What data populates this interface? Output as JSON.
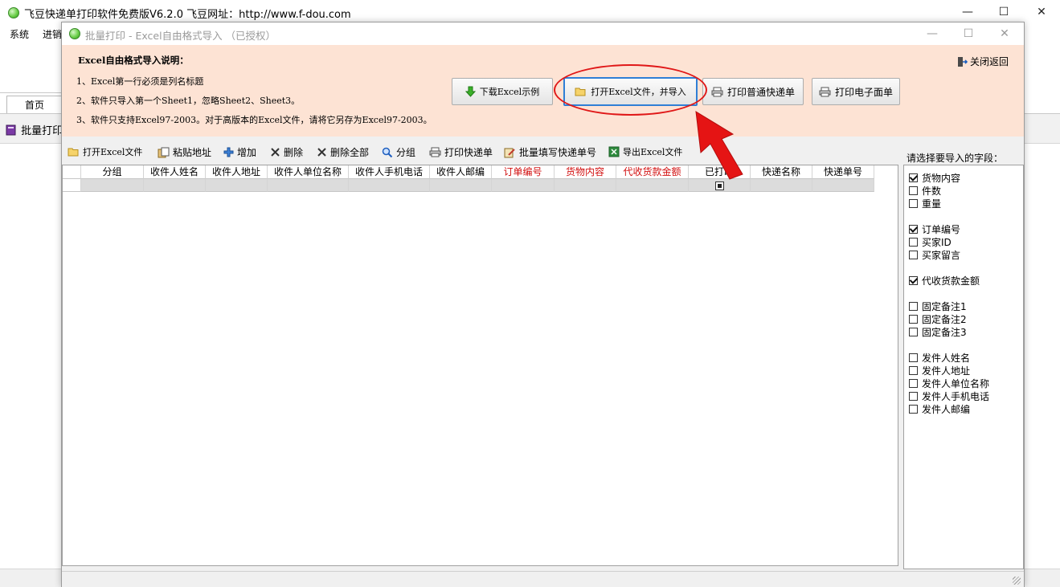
{
  "outer_window": {
    "title": "飞豆快递单打印软件免费版V6.2.0  飞豆网址：http://www.f-dou.com",
    "controls": {
      "minimize": "—",
      "maximize": "☐",
      "close": "✕"
    },
    "menu": [
      "系统",
      "进销"
    ],
    "tab_home": "首页",
    "sidebar_item": "批量打印"
  },
  "dialog": {
    "title": "批量打印 - Excel自由格式导入 （已授权）",
    "controls": {
      "minimize": "—",
      "maximize": "☐",
      "close": "✕"
    },
    "info": {
      "heading": "Excel自由格式导入说明：",
      "lines": [
        "1、Excel第一行必须是列名标题",
        "2、软件只导入第一个Sheet1，忽略Sheet2、Sheet3。",
        "3、软件只支持Excel97-2003。对于高版本的Excel文件，请将它另存为Excel97-2003。"
      ],
      "close_return": "关闭返回"
    },
    "buttons": {
      "download_example": "下载Excel示例",
      "open_import": "打开Excel文件，并导入",
      "print_normal": "打印普通快递单",
      "print_electronic": "打印电子面单"
    },
    "toolbar": [
      {
        "label": "打开Excel文件",
        "icon": "folder-icon"
      },
      {
        "label": "粘贴地址",
        "icon": "paste-icon"
      },
      {
        "label": "增加",
        "icon": "plus-icon"
      },
      {
        "label": "删除",
        "icon": "delete-icon"
      },
      {
        "label": "删除全部",
        "icon": "delete-all-icon"
      },
      {
        "label": "分组",
        "icon": "search-icon"
      },
      {
        "label": "打印快递单",
        "icon": "printer-icon"
      },
      {
        "label": "批量填写快递单号",
        "icon": "edit-icon"
      },
      {
        "label": "导出Excel文件",
        "icon": "excel-icon"
      }
    ],
    "grid": {
      "columns": [
        "",
        "分组",
        "收件人姓名",
        "收件人地址",
        "收件人单位名称",
        "收件人手机电话",
        "收件人邮编",
        "订单编号",
        "货物内容",
        "代收货款金额",
        "已打印",
        "快递名称",
        "快递单号"
      ],
      "red_columns": [
        "订单编号",
        "货物内容",
        "代收货款金额"
      ]
    },
    "fields_label": "请选择要导入的字段：",
    "fields": [
      {
        "label": "货物内容",
        "checked": true
      },
      {
        "label": "件数",
        "checked": false
      },
      {
        "label": "重量",
        "checked": false
      },
      {
        "label": "订单编号",
        "checked": true
      },
      {
        "label": "买家ID",
        "checked": false
      },
      {
        "label": "买家留言",
        "checked": false
      },
      {
        "label": "代收货款金额",
        "checked": true
      },
      {
        "label": "固定备注1",
        "checked": false
      },
      {
        "label": "固定备注2",
        "checked": false
      },
      {
        "label": "固定备注3",
        "checked": false
      },
      {
        "label": "发件人姓名",
        "checked": false
      },
      {
        "label": "发件人地址",
        "checked": false
      },
      {
        "label": "发件人单位名称",
        "checked": false
      },
      {
        "label": "发件人手机电话",
        "checked": false
      },
      {
        "label": "发件人邮编",
        "checked": false
      }
    ]
  },
  "colors": {
    "info_bg": "#fde3d4",
    "highlight_red": "#e01818",
    "red_text": "#d21010"
  }
}
